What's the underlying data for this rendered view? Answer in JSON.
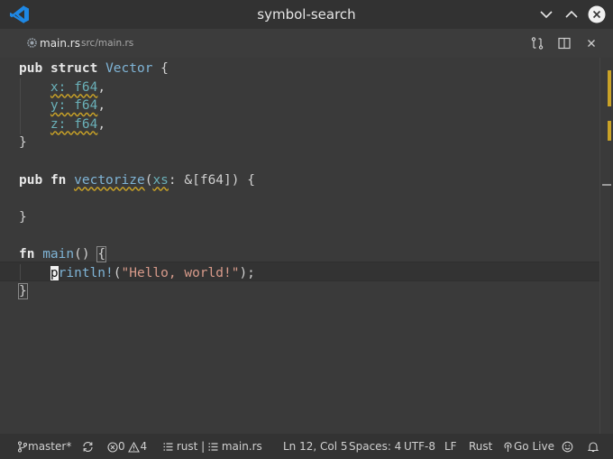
{
  "window": {
    "title": "symbol-search"
  },
  "tab": {
    "name": "main.rs",
    "path": "src/main.rs"
  },
  "code": {
    "l1_kw1": "pub",
    "l1_kw2": "struct",
    "l1_type": "Vector",
    "l1_rest": " {",
    "l2_field": "x: f64",
    "l3_field": "y: f64",
    "l4_field": "z: f64",
    "comma": ",",
    "close_brace": "}",
    "l6_kw1": "pub",
    "l6_kw2": "fn",
    "l6_fn": "vectorize",
    "l6_open": "(",
    "l6_param": "xs",
    "l6_rest": ": &[f64]) {",
    "l9_kw": "fn",
    "l9_fn": "main",
    "l9_rest": "() ",
    "l9_brace": "{",
    "l10_cursor": "p",
    "l10_macro": "rintln!",
    "l10_open": "(",
    "l10_str": "\"Hello, world!\"",
    "l10_close": ");",
    "l11_brace": "}"
  },
  "status": {
    "branch": "master*",
    "errors": "0",
    "warnings": "4",
    "lsp": "rust | ",
    "symbol": "main.rs",
    "position": "Ln 12, Col 5",
    "spaces": "Spaces: 4",
    "encoding": "UTF-8",
    "eol": "LF",
    "language": "Rust",
    "golive": "Go Live"
  },
  "colors": {
    "warning": "#c9a227",
    "accent": "#1e88e5"
  }
}
